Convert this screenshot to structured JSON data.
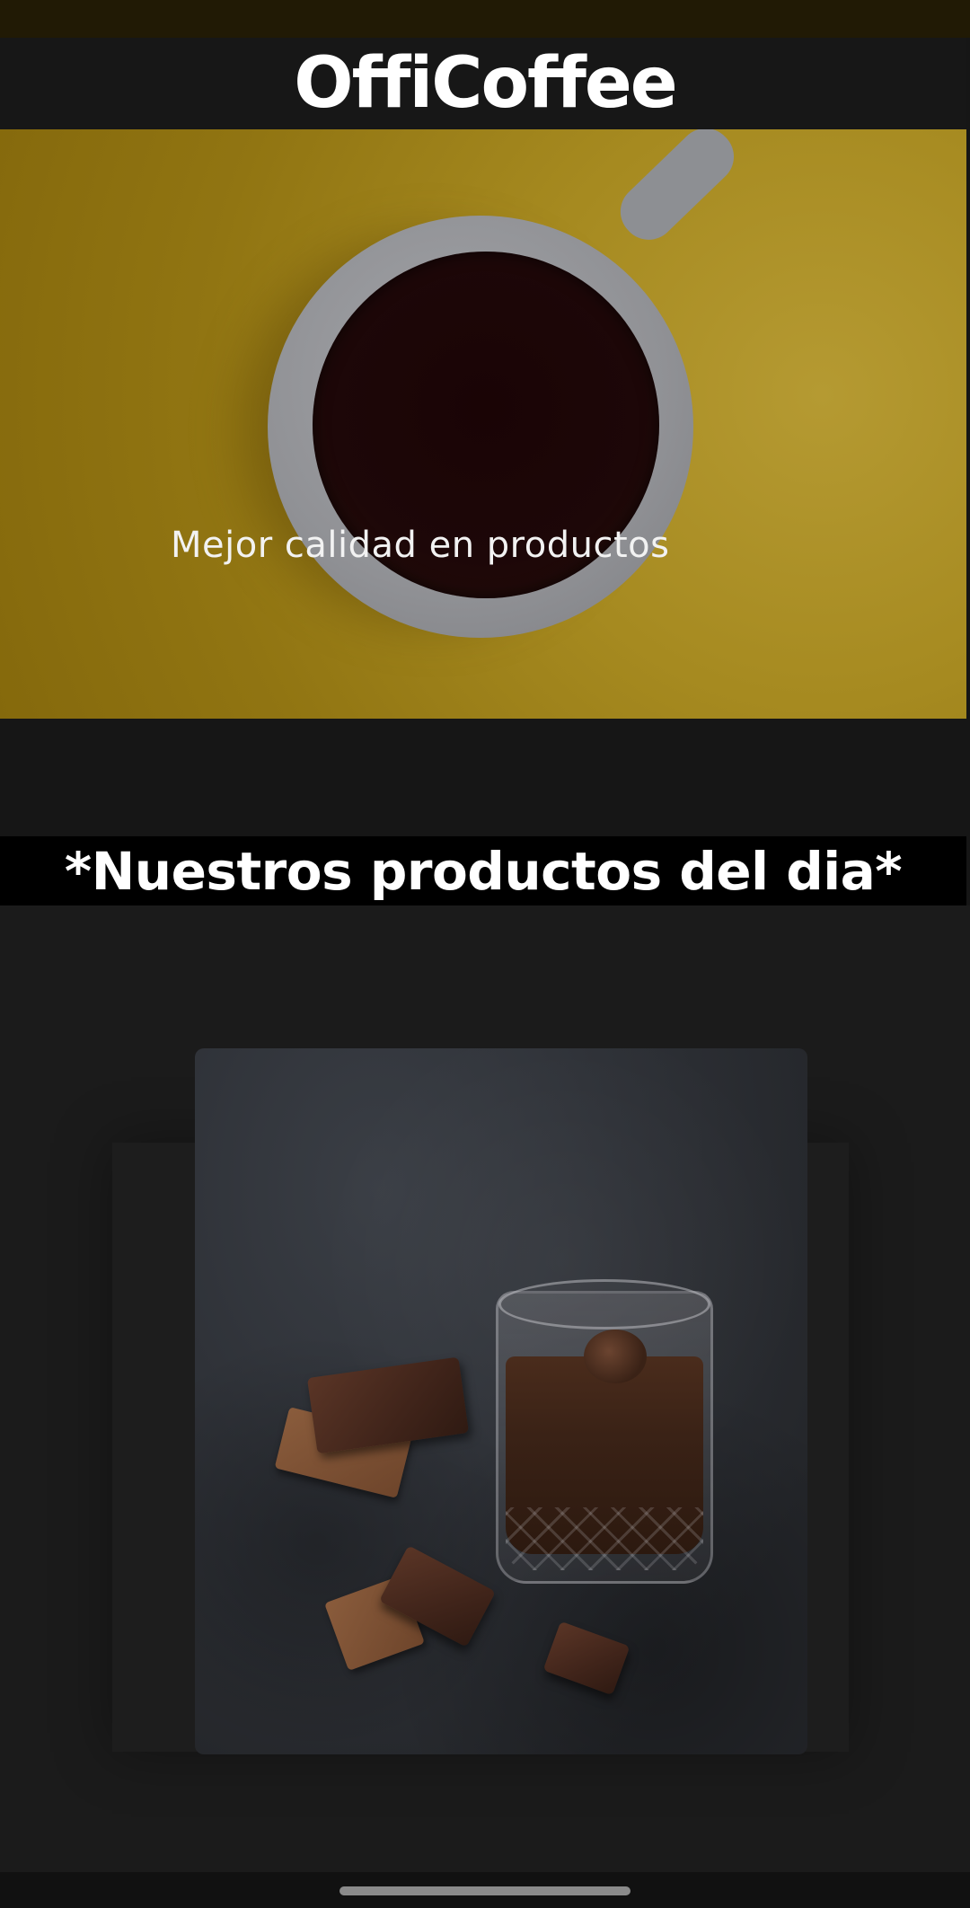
{
  "header": {
    "title": "OffiCoffee"
  },
  "hero": {
    "caption": "Mejor calidad en productos",
    "image_icon": "coffee-cup-photo"
  },
  "section": {
    "heading": "*Nuestros productos del dia*"
  },
  "product": {
    "image_icon": "chocolate-drink-photo"
  },
  "colors": {
    "background": "#161616",
    "hero_yellow": "#a68a20",
    "heading_band": "#000000",
    "text": "#ffffff"
  }
}
